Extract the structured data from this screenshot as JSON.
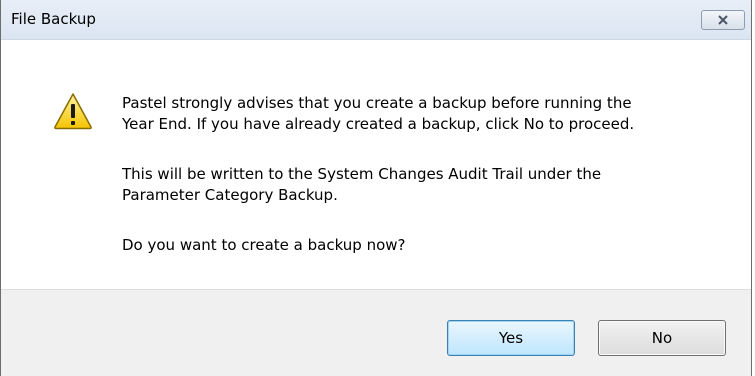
{
  "dialog": {
    "title": "File Backup",
    "close_icon": "close-icon",
    "warning_icon": "warning-icon",
    "message_paragraph_1_line_1": "Pastel strongly advises that you create a backup before running the",
    "message_paragraph_1_line_2": "Year End. If you have already created a backup, click No to proceed.",
    "message_paragraph_2_line_1": "This will be written to the System Changes Audit Trail under the",
    "message_paragraph_2_line_2": "Parameter Category Backup.",
    "message_question": "Do you want to create a backup now?",
    "buttons": {
      "yes_label": "Yes",
      "no_label": "No"
    }
  }
}
